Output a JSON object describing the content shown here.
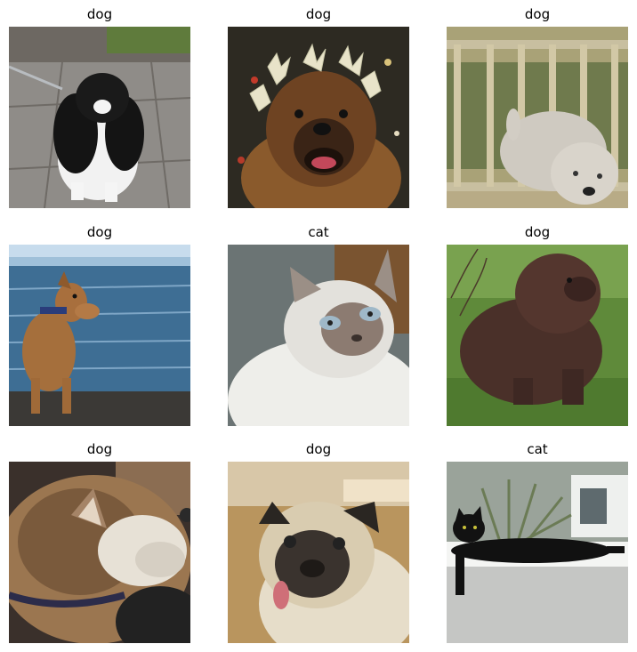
{
  "grid": {
    "cells": [
      {
        "label": "dog",
        "image": "japanese-chin-dog-on-pavement"
      },
      {
        "label": "dog",
        "image": "leonberger-dog-with-snowflake-antlers"
      },
      {
        "label": "dog",
        "image": "wheaten-terrier-on-deck"
      },
      {
        "label": "dog",
        "image": "dog-sitting-by-sea"
      },
      {
        "label": "cat",
        "image": "birman-cat-closeup"
      },
      {
        "label": "dog",
        "image": "newfoundland-dog-on-grass"
      },
      {
        "label": "dog",
        "image": "shiba-dog-sleeping"
      },
      {
        "label": "dog",
        "image": "pug-sticking-tongue-out"
      },
      {
        "label": "cat",
        "image": "black-cat-lying-on-ledge"
      }
    ]
  }
}
